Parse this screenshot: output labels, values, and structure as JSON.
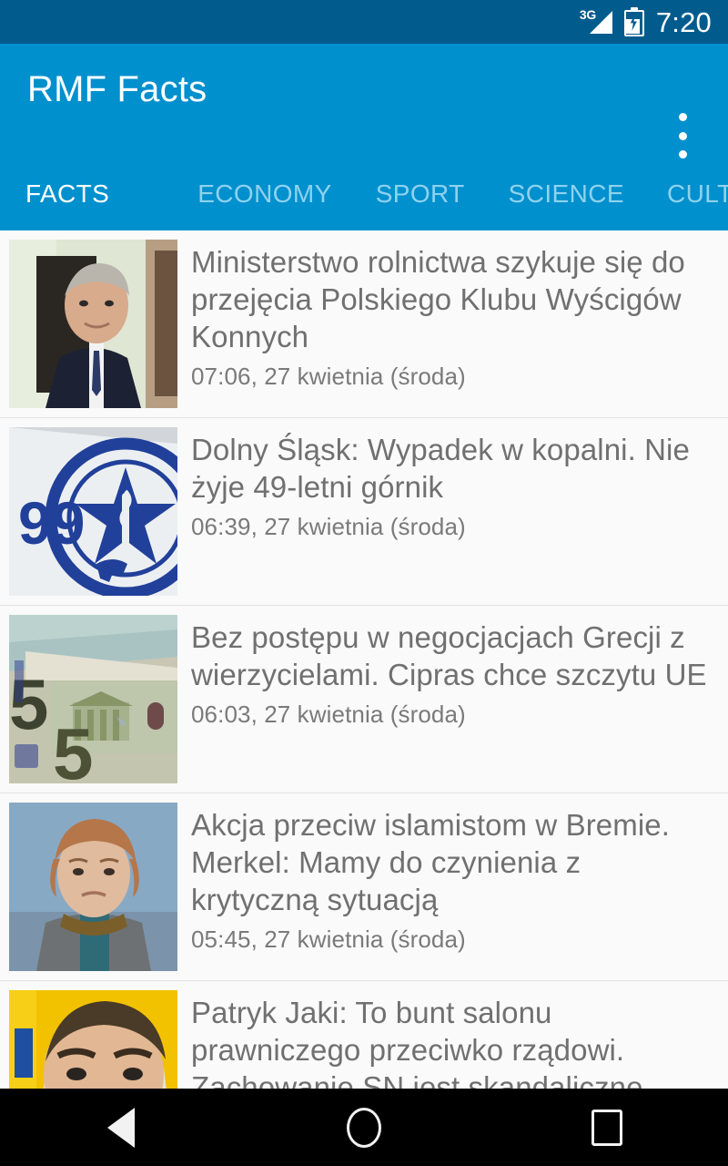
{
  "status_bar": {
    "network_label": "3G",
    "network_icon": "signal-bars-icon",
    "battery_icon": "battery-charging-icon",
    "time": "7:20"
  },
  "app_bar": {
    "title": "RMF Facts",
    "overflow_icon": "overflow-menu-icon",
    "background_color": "#0090CE",
    "status_bar_color": "#015C8D"
  },
  "tabs": {
    "active_index": 0,
    "items": [
      {
        "label": "FACTS"
      },
      {
        "label": "ECONOMY"
      },
      {
        "label": "SPORT"
      },
      {
        "label": "SCIENCE"
      },
      {
        "label": "CULTURE"
      }
    ]
  },
  "news": {
    "items": [
      {
        "headline": "Ministerstwo rolnictwa szykuje się do przejęcia Polskiego Klubu Wyścigów Konnych",
        "timestamp": "07:06, 27 kwietnia (środa)",
        "thumbnail": "portrait-man-in-suit-photo"
      },
      {
        "headline": "Dolny Śląsk: Wypadek w kopalni. Nie żyje 49-letni górnik",
        "timestamp": "06:39, 27 kwietnia (środa)",
        "thumbnail": "ambulance-rescue-emblem-photo"
      },
      {
        "headline": "Bez postępu w negocjacjach Grecji z wierzycielami. Cipras chce szczytu UE",
        "timestamp": "06:03, 27 kwietnia (środa)",
        "thumbnail": "euro-banknotes-photo"
      },
      {
        "headline": "Akcja przeciw islamistom w Bremie. Merkel: Mamy do czynienia z krytyczną sytuacją",
        "timestamp": "05:45, 27 kwietnia (środa)",
        "thumbnail": "portrait-woman-merkel-photo"
      },
      {
        "headline": "Patryk Jaki: To bunt salonu prawniczego przeciwko rządowi. Zachowanie SN jest skandaliczne",
        "timestamp": "",
        "thumbnail": "portrait-man-yellow-background-photo"
      }
    ]
  },
  "nav_bar": {
    "back_icon": "back-triangle-icon",
    "home_icon": "home-circle-icon",
    "recents_icon": "recents-square-icon"
  }
}
